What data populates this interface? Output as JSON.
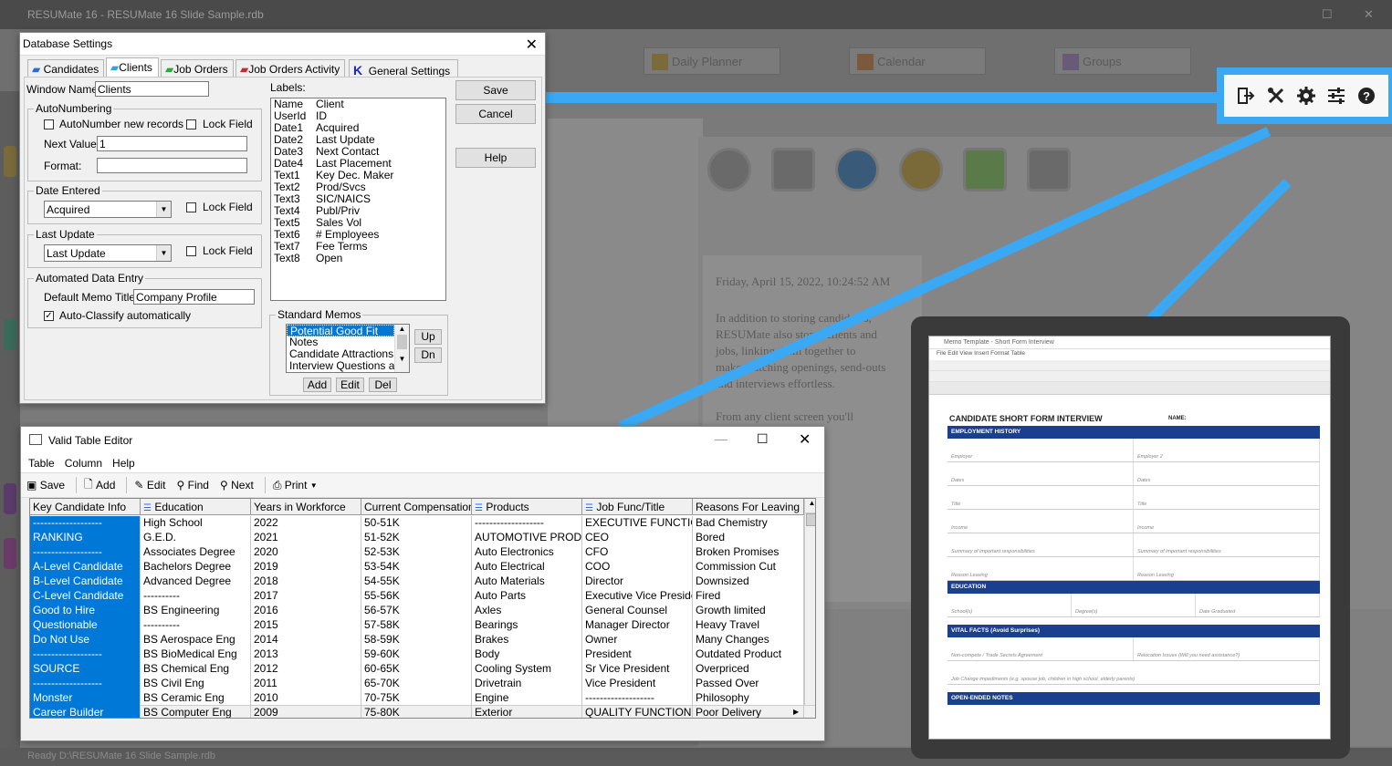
{
  "background": {
    "title": "RESUMate 16 - RESUMate 16 Slide Sample.rdb",
    "tabs": [
      "Daily Planner",
      "Calendar",
      "Groups"
    ],
    "status": "Ready    D:\\RESUMate 16 Slide Sample.rdb",
    "doc_lines": [
      "Friday, April 15, 2022, 10:24:52 AM",
      "In addition to storing candidates,",
      "RESUMate also stores clients and",
      "jobs, linking them together to",
      "make matching openings, send-outs",
      "and interviews effortless.",
      "From any client screen you'll",
      "",
      "",
      "",
      "",
      ""
    ]
  },
  "toolbar_zoom": {
    "icons": [
      "exit-icon",
      "tools-icon",
      "gear-icon",
      "settings-sliders-icon",
      "help-icon"
    ]
  },
  "memo_preview": {
    "title": "Memo Template - Short Form Interview",
    "menu": "File   Edit   View   Insert   Format   Table",
    "doc_title": "CANDIDATE SHORT FORM INTERVIEW",
    "name_label": "NAME:",
    "sections": [
      "EMPLOYMENT HISTORY",
      "EDUCATION",
      "VITAL FACTS (Avoid Surprises)",
      "OPEN-ENDED NOTES"
    ],
    "emp_rows": [
      [
        "Employer",
        "Employer 2"
      ],
      [
        "Dates",
        "Dates"
      ],
      [
        "Title",
        "Title"
      ],
      [
        "Income",
        "Income"
      ],
      [
        "Summary of important responsibilities",
        "Summary of important responsibilities"
      ],
      [
        "Reason Leaving",
        "Reason Leaving"
      ]
    ],
    "edu_row": [
      "School(s)",
      "Degree(s)",
      "Date Graduated"
    ],
    "vital_rows": [
      [
        "Non-compete / Trade Secrets Agreement",
        "Relocation Issues (Will you need assistance?)"
      ],
      [
        "Job Change impediments (e.g. spouse job, children in high school, elderly parents)",
        ""
      ]
    ]
  },
  "db_settings": {
    "title": "Database Settings",
    "tabs": [
      "Candidates",
      "Clients",
      "Job Orders",
      "Job Orders Activity",
      "General Settings"
    ],
    "window_name_label": "Window Name:",
    "window_name_value": "Clients",
    "autonumbering": {
      "title": "AutoNumbering",
      "auto_label": "AutoNumber new records",
      "lock_label": "Lock Field",
      "next_label": "Next Value:",
      "next_value": "1",
      "format_label": "Format:",
      "format_value": ""
    },
    "date_entered": {
      "title": "Date Entered",
      "value": "Acquired",
      "lock_label": "Lock Field"
    },
    "last_update": {
      "title": "Last Update",
      "value": "Last Update",
      "lock_label": "Lock Field"
    },
    "automated": {
      "title": "Automated Data Entry",
      "memo_label": "Default Memo Title:",
      "memo_value": "Company Profile",
      "classify_label": "Auto-Classify automatically"
    },
    "labels_title": "Labels:",
    "labels": [
      [
        "Name",
        "Client"
      ],
      [
        "UserId",
        "ID"
      ],
      [
        "Date1",
        "Acquired"
      ],
      [
        "Date2",
        "Last Update"
      ],
      [
        "Date3",
        "Next Contact"
      ],
      [
        "Date4",
        "Last Placement"
      ],
      [
        "Text1",
        "Key Dec. Maker"
      ],
      [
        "Text2",
        "Prod/Svcs"
      ],
      [
        "Text3",
        "SIC/NAICS"
      ],
      [
        "Text4",
        "Publ/Priv"
      ],
      [
        "Text5",
        "Sales Vol"
      ],
      [
        "Text6",
        "# Employees"
      ],
      [
        "Text7",
        "Fee Terms"
      ],
      [
        "Text8",
        "Open"
      ]
    ],
    "standard_memos": {
      "title": "Standard Memos",
      "items": [
        "Potential Good Fit",
        "Notes",
        "Candidate Attractions",
        "Interview Questions and"
      ],
      "up": "Up",
      "dn": "Dn",
      "add": "Add",
      "edit": "Edit",
      "del": "Del"
    },
    "buttons": {
      "save": "Save",
      "cancel": "Cancel",
      "help": "Help"
    }
  },
  "valid_table_editor": {
    "title": "Valid Table Editor",
    "menu": [
      "Table",
      "Column",
      "Help"
    ],
    "toolbar": {
      "save": "Save",
      "add": "Add",
      "edit": "Edit",
      "find": "Find",
      "next": "Next",
      "print": "Print"
    },
    "columns": [
      "Key Candidate Info",
      "Education",
      "Years in Workforce",
      "Current Compensation",
      "Products",
      "Job Func/Title",
      "Reasons For Leaving"
    ],
    "rows": [
      [
        "-------------------",
        "High School",
        "2022",
        "50-51K",
        "-------------------",
        "EXECUTIVE FUNCTION",
        "Bad Chemistry"
      ],
      [
        "RANKING",
        "G.E.D.",
        "2021",
        "51-52K",
        "AUTOMOTIVE PRODU",
        "CEO",
        "Bored"
      ],
      [
        "-------------------",
        "Associates Degree",
        "2020",
        "52-53K",
        "Auto Electronics",
        "CFO",
        "Broken Promises"
      ],
      [
        "A-Level Candidate",
        "Bachelors Degree",
        "2019",
        "53-54K",
        "Auto Electrical",
        "COO",
        "Commission Cut"
      ],
      [
        "B-Level Candidate",
        "Advanced Degree",
        "2018",
        "54-55K",
        "Auto Materials",
        "Director",
        "Downsized"
      ],
      [
        "C-Level Candidate",
        "----------",
        "2017",
        "55-56K",
        "Auto Parts",
        "Executive Vice President",
        "Fired"
      ],
      [
        "Good to Hire",
        "BS Engineering",
        "2016",
        "56-57K",
        "Axles",
        "General Counsel",
        "Growth limited"
      ],
      [
        "Questionable",
        "----------",
        "2015",
        "57-58K",
        "Bearings",
        "Manager Director",
        "Heavy Travel"
      ],
      [
        "Do Not Use",
        "BS Aerospace Eng",
        "2014",
        "58-59K",
        "Brakes",
        "Owner",
        "Many Changes"
      ],
      [
        "-------------------",
        "BS BioMedical Eng",
        "2013",
        "59-60K",
        "Body",
        "President",
        "Outdated Product"
      ],
      [
        "SOURCE",
        "BS Chemical Eng",
        "2012",
        "60-65K",
        "Cooling System",
        "Sr Vice President",
        "Overpriced"
      ],
      [
        "-------------------",
        "BS Civil Eng",
        "2011",
        "65-70K",
        "Drivetrain",
        "Vice President",
        "Passed Over"
      ],
      [
        "Monster",
        "BS Ceramic Eng",
        "2010",
        "70-75K",
        "Engine",
        "-------------------",
        "Philosophy"
      ],
      [
        "Career  Builder",
        "BS Computer Eng",
        "2009",
        "75-80K",
        "Exterior",
        "QUALITY FUNCTION",
        "Poor Delivery"
      ]
    ]
  },
  "colors": {
    "accent_blue": "#3aa8f2",
    "selection": "#0078d7",
    "memo_header": "#1b3f8f"
  }
}
